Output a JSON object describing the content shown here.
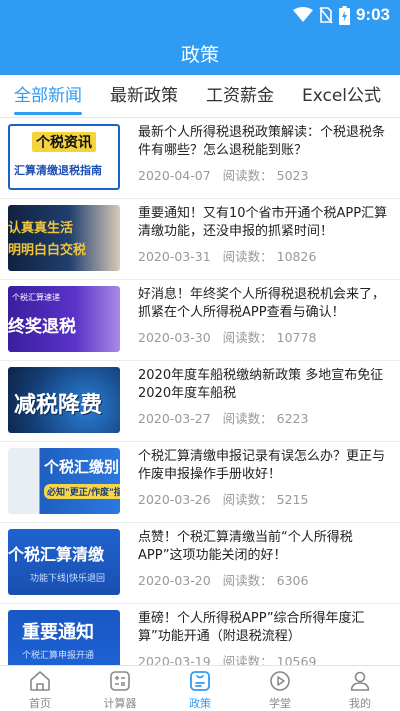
{
  "status_bar": {
    "time": "9:03",
    "icons": [
      "wifi-icon",
      "no-sim-icon",
      "battery-charging-icon"
    ]
  },
  "app_bar": {
    "title": "政策"
  },
  "tabs": [
    {
      "label": "全部新闻",
      "active": true
    },
    {
      "label": "最新政策",
      "active": false
    },
    {
      "label": "工资薪金",
      "active": false
    },
    {
      "label": "Excel公式",
      "active": false
    }
  ],
  "news": [
    {
      "title": "最新个人所得税退税政策解读：个税退税条件有哪些？怎么退税能到账？",
      "date": "2020-04-07",
      "reads_label": "阅读数：",
      "reads": "5023",
      "thumb_text": [
        "个税资讯",
        "汇算清缴退税指南"
      ]
    },
    {
      "title": "重要通知！又有10个省市开通个税APP汇算清缴功能，还没申报的抓紧时间！",
      "date": "2020-03-31",
      "reads_label": "阅读数：",
      "reads": "10826",
      "thumb_text": [
        "认真真生活",
        "明明白白交税"
      ]
    },
    {
      "title": "好消息！年终奖个人所得税退税机会来了，抓紧在个人所得税APP查看与确认！",
      "date": "2020-03-30",
      "reads_label": "阅读数：",
      "reads": "10778",
      "thumb_text": [
        "个税汇算速递",
        "终奖退税"
      ]
    },
    {
      "title": "2020年度车船税缴纳新政策 多地宣布免征2020年度车船税",
      "date": "2020-03-27",
      "reads_label": "阅读数：",
      "reads": "6223",
      "thumb_text": [
        "减税降费"
      ]
    },
    {
      "title": "个税汇算清缴申报记录有误怎么办？更正与作废申报操作手册收好！",
      "date": "2020-03-26",
      "reads_label": "阅读数：",
      "reads": "5215",
      "thumb_text": [
        "个税汇缴别",
        "必知\"更正/作废\"指"
      ]
    },
    {
      "title": "点赞！个税汇算清缴当前“个人所得税APP”这项功能关闭的好！",
      "date": "2020-03-20",
      "reads_label": "阅读数：",
      "reads": "6306",
      "thumb_text": [
        "个税汇算清缴",
        "功能下线|快乐退回"
      ]
    },
    {
      "title": "重磅！个人所得税APP”综合所得年度汇算”功能开通（附退税流程）",
      "date": "2020-03-19",
      "reads_label": "阅读数：",
      "reads": "10569",
      "thumb_text": [
        "重要通知",
        "个税汇算申报开通"
      ]
    }
  ],
  "bottom_nav": [
    {
      "label": "首页",
      "icon": "home-icon",
      "active": false
    },
    {
      "label": "计算器",
      "icon": "calculator-icon",
      "active": false
    },
    {
      "label": "政策",
      "icon": "policy-icon",
      "active": true
    },
    {
      "label": "学堂",
      "icon": "play-icon",
      "active": false
    },
    {
      "label": "我的",
      "icon": "user-icon",
      "active": false
    }
  ],
  "colors": {
    "primary": "#2f9bf3",
    "text": "#222222",
    "meta": "#999999"
  }
}
